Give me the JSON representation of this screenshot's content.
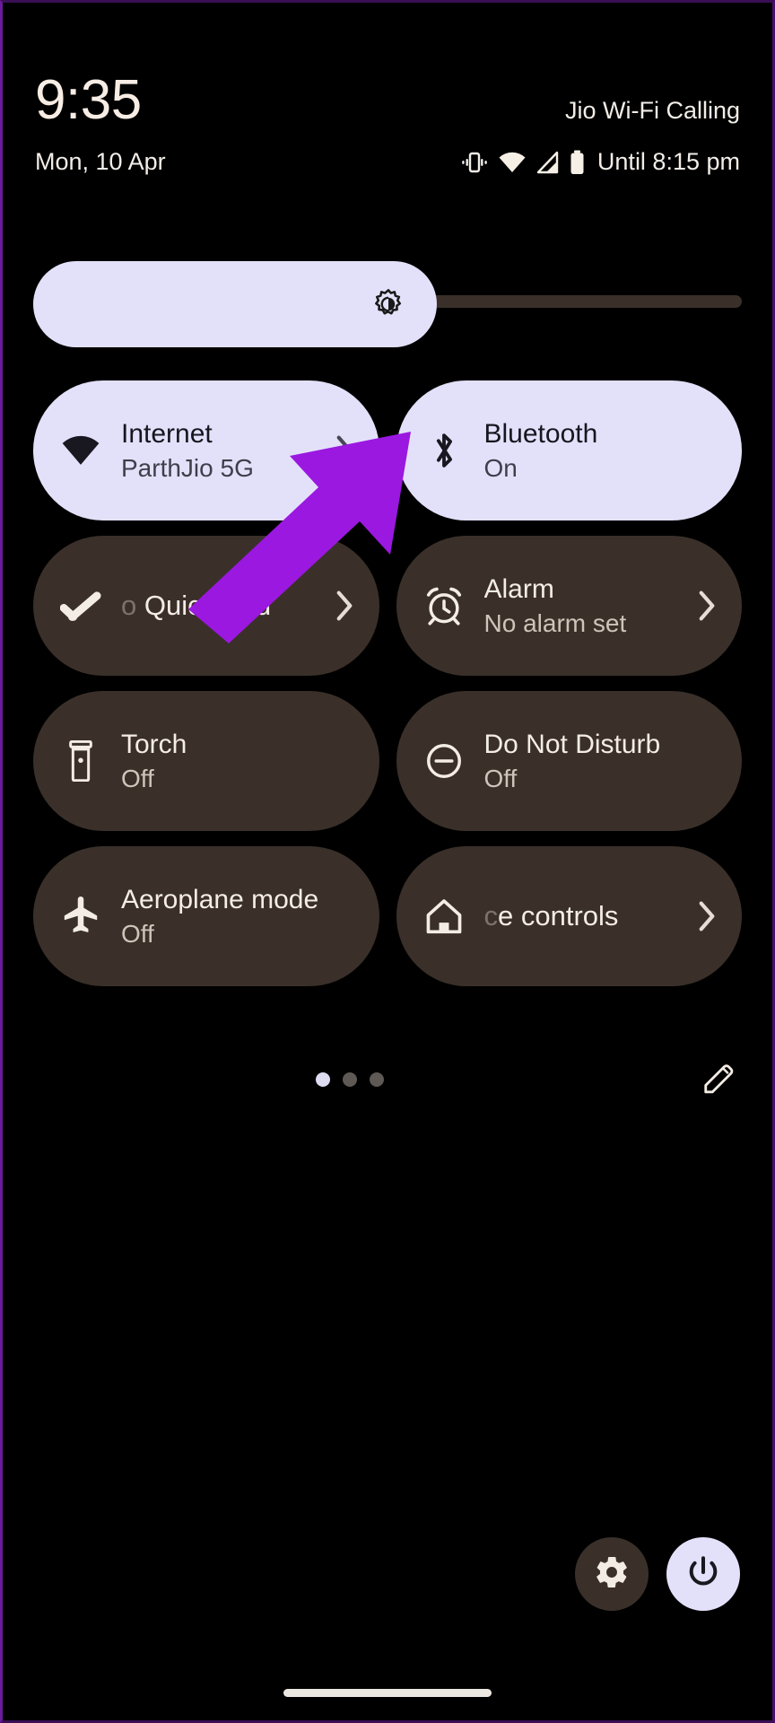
{
  "statusbar": {
    "clock": "9:35",
    "date": "Mon, 10 Apr",
    "carrier": "Jio Wi-Fi Calling",
    "battery_text": "Until 8:15 pm",
    "icons": [
      "vibrate-icon",
      "wifi-icon",
      "cell-signal-icon",
      "battery-icon"
    ]
  },
  "brightness": {
    "icon": "brightness-icon",
    "percent": 57,
    "fill_color": "#E3E1FA",
    "track_color": "#3A3029"
  },
  "tiles": [
    {
      "name": "internet",
      "icon": "wifi-icon",
      "label": "Internet",
      "sub": "ParthJio 5G",
      "state": "active",
      "chevron": true,
      "single_line": false,
      "fade_prefix": ""
    },
    {
      "name": "bluetooth",
      "icon": "bluetooth-icon",
      "label": "Bluetooth",
      "sub": "On",
      "state": "active",
      "chevron": false,
      "single_line": false,
      "fade_prefix": ""
    },
    {
      "name": "quick-add",
      "icon": "check-icon",
      "label": "Quick Add",
      "sub": "",
      "state": "inactive",
      "chevron": true,
      "single_line": true,
      "fade_prefix": "o "
    },
    {
      "name": "alarm",
      "icon": "alarm-icon",
      "label": "Alarm",
      "sub": "No alarm set",
      "state": "inactive",
      "chevron": true,
      "single_line": false,
      "fade_prefix": ""
    },
    {
      "name": "torch",
      "icon": "flashlight-icon",
      "label": "Torch",
      "sub": "Off",
      "state": "inactive",
      "chevron": false,
      "single_line": false,
      "fade_prefix": ""
    },
    {
      "name": "do-not-disturb",
      "icon": "minus-circle-icon",
      "label": "Do Not Disturb",
      "sub": "Off",
      "state": "inactive",
      "chevron": false,
      "single_line": false,
      "fade_prefix": ""
    },
    {
      "name": "aeroplane-mode",
      "icon": "airplane-icon",
      "label": "Aeroplane mode",
      "sub": "Off",
      "state": "inactive",
      "chevron": false,
      "single_line": false,
      "fade_prefix": ""
    },
    {
      "name": "device-controls",
      "icon": "home-icon",
      "label": "ce controls",
      "sub": "",
      "state": "inactive",
      "chevron": true,
      "single_line": true,
      "fade_prefix": "c"
    }
  ],
  "pager": {
    "total_pages": 3,
    "current_page": 1,
    "edit_icon": "pencil-icon"
  },
  "bottom": {
    "settings_icon": "gear-icon",
    "power_icon": "power-icon"
  },
  "annotation": {
    "type": "arrow",
    "color": "#9B18E0",
    "points_to": "bluetooth-tile"
  },
  "colors": {
    "background": "#000000",
    "tile_active": "#E3E1FA",
    "tile_inactive": "#3A3029",
    "text_primary": "#F4EDE6",
    "text_on_active": "#17151E"
  }
}
